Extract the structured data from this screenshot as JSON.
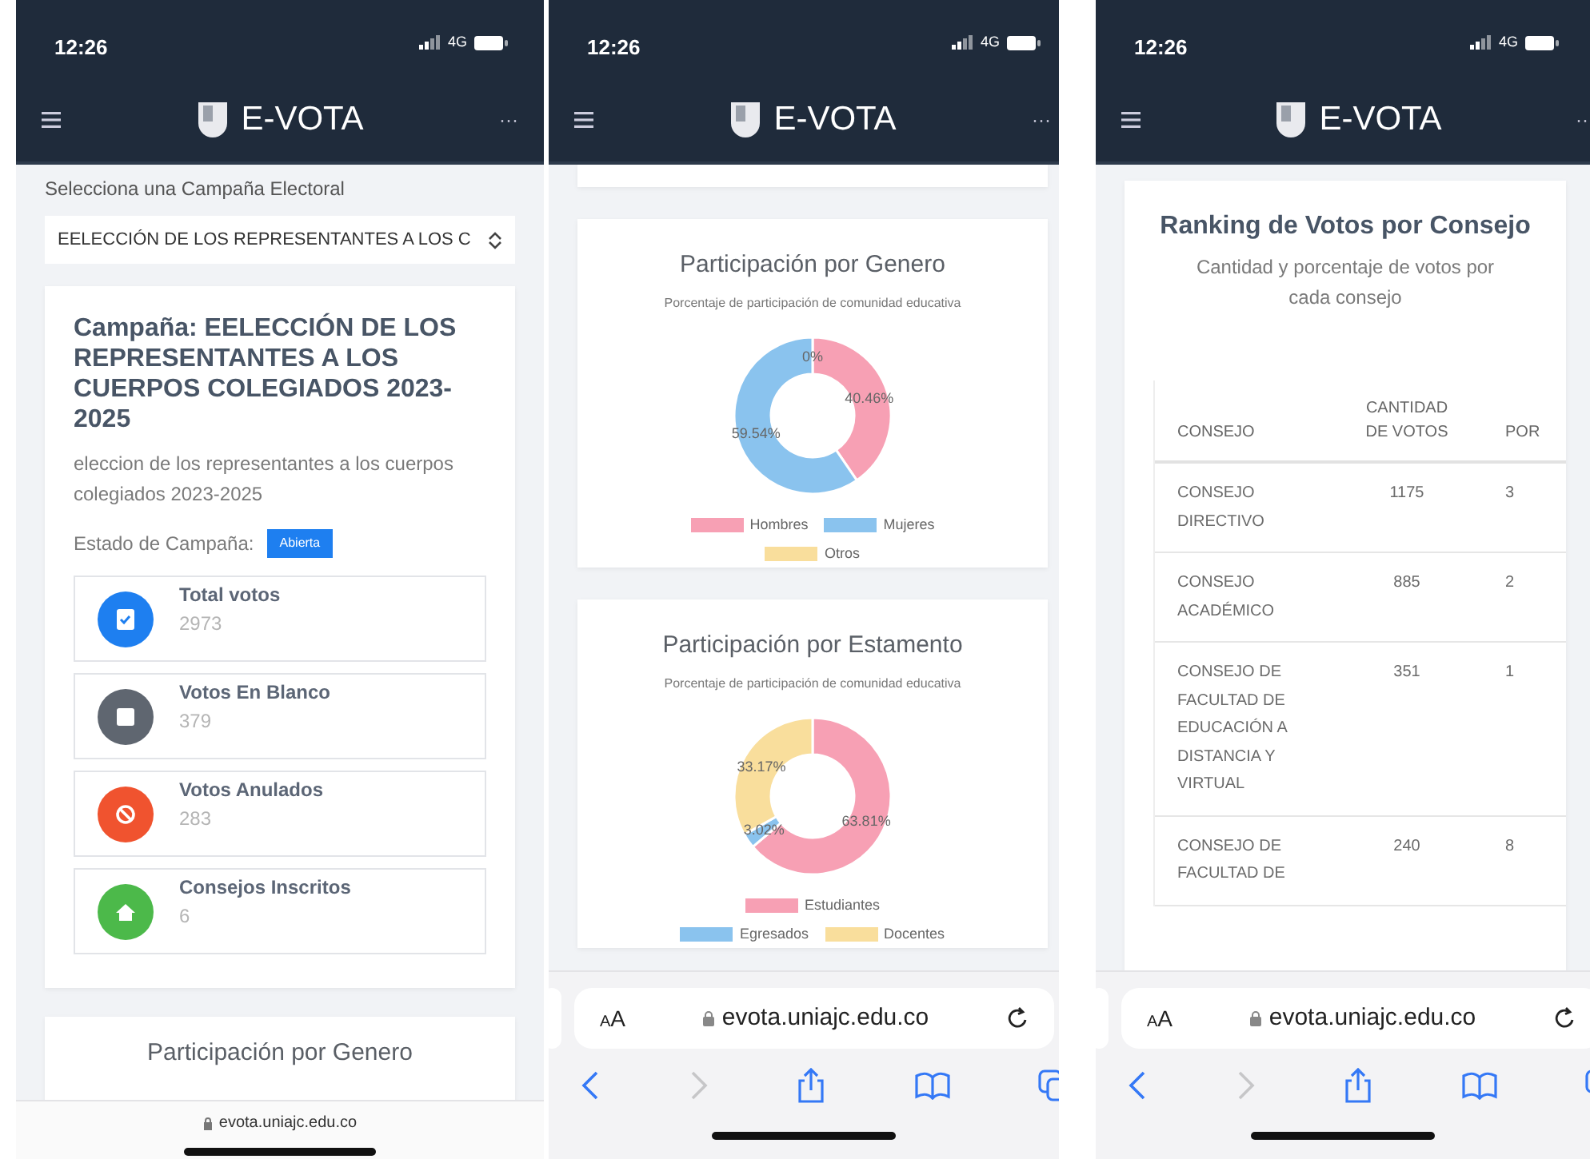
{
  "phones": [
    {
      "kind": "campaign",
      "status_bar": {
        "time": "12:26",
        "network": "4G"
      },
      "navbar": {
        "title": "E-VOTA",
        "more": "···"
      },
      "select_label": "Selecciona una Campaña Electoral",
      "select_value": "EELECCIÓN DE LOS REPRESENTANTES A LOS C",
      "campaign": {
        "title": "Campaña: EELECCIÓN DE LOS REPRESENTANTES A LOS CUERPOS COLEGIADOS 2023-2025",
        "description": "eleccion de los representantes a los cuerpos colegiados 2023-2025",
        "status_label": "Estado de Campaña:",
        "status_badge": "Abierta"
      },
      "stats": [
        {
          "label": "Total votos",
          "value": "2973",
          "color": "#1e7ff0"
        },
        {
          "label": "Votos En Blanco",
          "value": "379",
          "color": "#5f6670"
        },
        {
          "label": "Votos Anulados",
          "value": "283",
          "color": "#f0532f"
        },
        {
          "label": "Consejos Inscritos",
          "value": "6",
          "color": "#4cb94a"
        }
      ],
      "next_card_title": "Participación por Genero",
      "address": "evota.uniajc.edu.co"
    },
    {
      "kind": "charts",
      "status_bar": {
        "time": "12:26",
        "network": "4G"
      },
      "navbar": {
        "title": "E-VOTA",
        "more": "···"
      },
      "charts": [
        {
          "title": "Participación por Genero",
          "subtitle": "Porcentaje de participación de comunidad educativa",
          "chart_data": {
            "type": "donut",
            "categories": [
              "Hombres",
              "Mujeres",
              "Otros"
            ],
            "values": [
              40.46,
              59.54,
              0
            ],
            "value_labels": [
              "40.46%",
              "59.54%",
              "0%"
            ],
            "colors": [
              "#f7a0b4",
              "#8ac3ee",
              "#f9de9c"
            ]
          }
        },
        {
          "title": "Participación por Estamento",
          "subtitle": "Porcentaje de participación de comunidad educativa",
          "chart_data": {
            "type": "donut",
            "categories": [
              "Estudiantes",
              "Egresados",
              "Docentes"
            ],
            "values": [
              63.81,
              3.02,
              33.17
            ],
            "value_labels": [
              "63.81%",
              "3.02%",
              "33.17%"
            ],
            "colors": [
              "#f7a0b4",
              "#8ac3ee",
              "#f9de9c"
            ]
          }
        }
      ],
      "browser": {
        "text_size": "AA",
        "address": "evota.uniajc.edu.co"
      }
    },
    {
      "kind": "ranking",
      "status_bar": {
        "time": "12:26",
        "network": "4G"
      },
      "navbar": {
        "title": "E-VOTA",
        "more": "··"
      },
      "ranking": {
        "title": "Ranking de Votos por Consejo",
        "subtitle": "Cantidad y porcentaje de votos por cada consejo",
        "columns": [
          "CONSEJO",
          "CANTIDAD DE VOTOS",
          "POR"
        ],
        "rows": [
          [
            "CONSEJO DIRECTIVO",
            "1175",
            "3"
          ],
          [
            "CONSEJO ACADÉMICO",
            "885",
            "2"
          ],
          [
            "CONSEJO DE FACULTAD DE EDUCACIÓN A DISTANCIA Y VIRTUAL",
            "351",
            "1"
          ],
          [
            "CONSEJO DE FACULTAD DE",
            "240",
            "8"
          ]
        ]
      },
      "browser": {
        "text_size": "AA",
        "address": "evota.uniajc.edu.co"
      }
    }
  ]
}
